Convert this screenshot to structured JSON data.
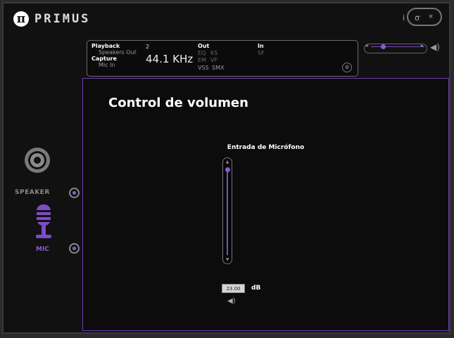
{
  "header": {
    "logo_glyph": "π",
    "brand": "PRIMUS",
    "info_icon": "i",
    "settings_icon": "o",
    "minimize_icon": "−",
    "close_icon": "×"
  },
  "status": {
    "playback_label": "Playback",
    "playback_device": "Speakers Out",
    "capture_label": "Capture",
    "capture_device": "Mic In",
    "channels": "2",
    "sample_rate": "44.1 KHz",
    "out_label": "Out",
    "out_eq": "EQ",
    "out_ks": "KS",
    "out_em": "EM",
    "out_vf": "VF",
    "out_vss": "VSS",
    "out_smx": "SMX",
    "in_label": "In",
    "in_sf": "SF"
  },
  "master_volume": {
    "left_arrow": "◂·",
    "right_arrow": "·▸",
    "level": 0.2,
    "icon": "speaker-icon"
  },
  "sidebar": {
    "speaker_label": "SPEAKER",
    "mic_label": "MIC",
    "speaker_selected": true,
    "mic_selected": true
  },
  "panel": {
    "title": "Control de volumen",
    "channel_label": "Entrada de Micrófono",
    "level": 0.95,
    "db_value": "23.00",
    "db_unit": "dB"
  },
  "colors": {
    "accent": "#7d4bc8",
    "background": "#111111"
  }
}
